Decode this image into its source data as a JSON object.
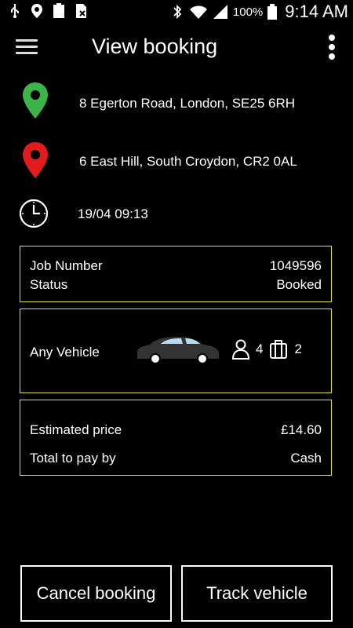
{
  "status_bar": {
    "battery_percent": "100%",
    "time": "9:14 AM",
    "icons": [
      "usb-icon",
      "location-icon",
      "battery-100-icon",
      "sim-icon",
      "bluetooth-icon",
      "wifi-icon",
      "signal-icon",
      "battery-icon"
    ]
  },
  "header": {
    "title": "View booking",
    "menu_icon": "hamburger-menu-icon",
    "more_icon": "more-vert-icon"
  },
  "trip": {
    "pickup": "8 Egerton Road, London, SE25 6RH",
    "dropoff": "6 East Hill, South Croydon, CR2 0AL",
    "datetime": "19/04 09:13",
    "pickup_pin_color": "#3db34a",
    "dropoff_pin_color": "#e21c1c"
  },
  "job": {
    "job_number_label": "Job Number",
    "job_number": "1049596",
    "status_label": "Status",
    "status": "Booked"
  },
  "vehicle": {
    "type": "Any Vehicle",
    "passengers": "4",
    "luggage": "2"
  },
  "payment": {
    "estimated_price_label": "Estimated price",
    "estimated_price": "£14.60",
    "pay_by_label": "Total to pay by",
    "pay_by": "Cash"
  },
  "actions": {
    "cancel_label": "Cancel booking",
    "track_label": "Track vehicle"
  },
  "colors": {
    "card_border": "#e1e13a",
    "background": "#000000"
  }
}
